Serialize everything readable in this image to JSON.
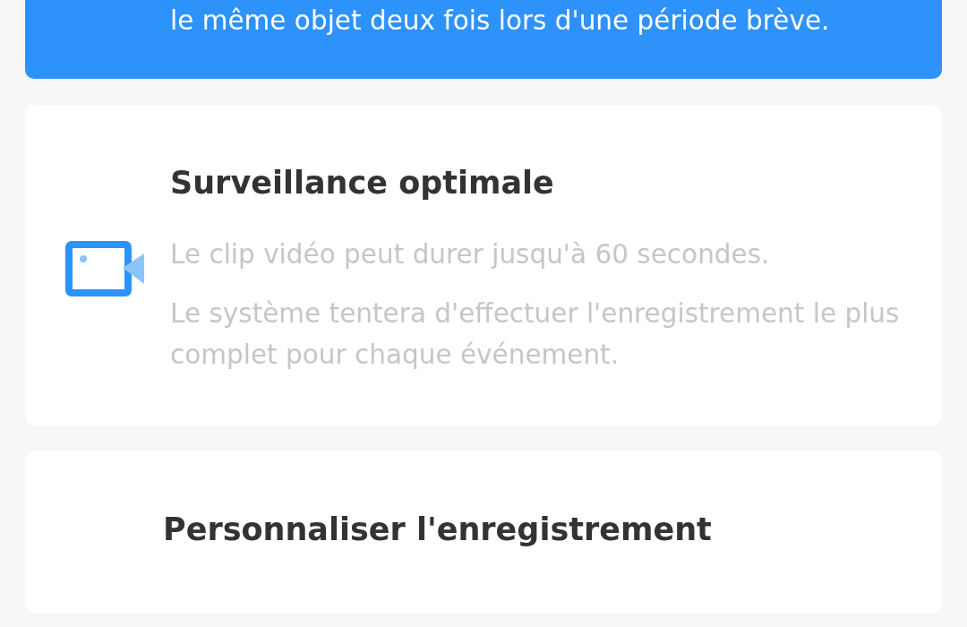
{
  "options": [
    {
      "kind": "text",
      "selected": true,
      "paragraphs": [
        "le même objet deux fois lors d'une période brève."
      ]
    },
    {
      "kind": "video",
      "selected": false,
      "title": "Surveillance optimale",
      "paragraphs": [
        "Le clip vidéo peut durer jusqu'à 60 secondes.",
        "Le système tentera d'effectuer l'enregistrement le plus complet pour chaque événement."
      ]
    },
    {
      "kind": "custom",
      "selected": false,
      "title": "Personnaliser l'enregistrement"
    }
  ]
}
